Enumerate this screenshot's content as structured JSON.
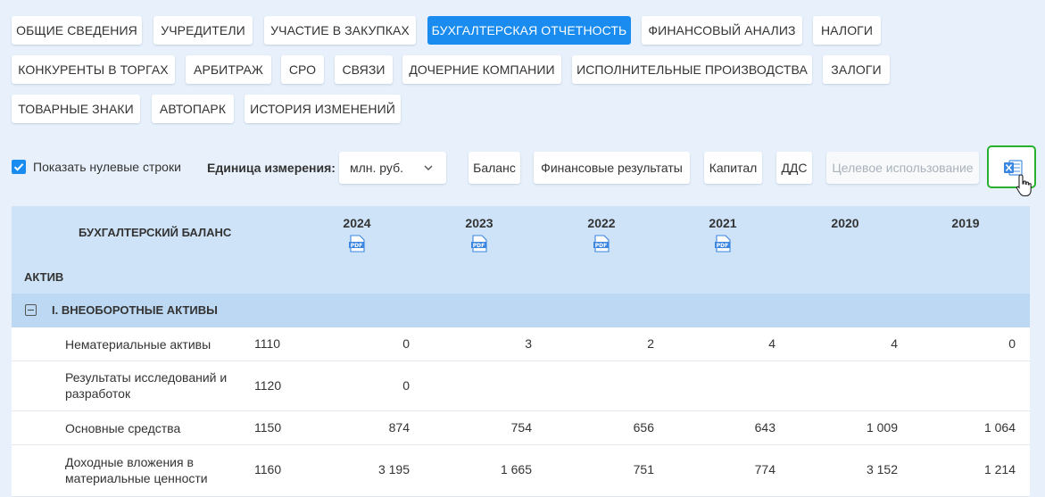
{
  "tabs_row1": [
    "ОБЩИЕ СВЕДЕНИЯ",
    "УЧРЕДИТЕЛИ",
    "УЧАСТИЕ В ЗАКУПКАХ",
    "БУХГАЛТЕРСКАЯ ОТЧЕТНОСТЬ",
    "ФИНАНСОВЫЙ АНАЛИЗ",
    "НАЛОГИ"
  ],
  "tabs_row2": [
    "КОНКУРЕНТЫ В ТОРГАХ",
    "АРБИТРАЖ",
    "СРО",
    "СВЯЗИ",
    "ДОЧЕРНИЕ КОМПАНИИ",
    "ИСПОЛНИТЕЛЬНЫЕ ПРОИЗВОДСТВА",
    "ЗАЛОГИ"
  ],
  "tabs_row3": [
    "ТОВАРНЫЕ ЗНАКИ",
    "АВТОПАРК",
    "ИСТОРИЯ ИЗМЕНЕНИЙ"
  ],
  "active_tab": "БУХГАЛТЕРСКАЯ ОТЧЕТНОСТЬ",
  "toolbar": {
    "show_zero_rows": "Показать нулевые строки",
    "show_zero_checked": true,
    "unit_label": "Единица измерения:",
    "unit_value": "млн. руб.",
    "buttons": [
      "Баланс",
      "Финансовые результаты",
      "Капитал",
      "ДДС",
      "Целевое использование"
    ],
    "disabled_button": "Целевое использование",
    "export_icon": "excel-icon"
  },
  "table": {
    "title": "БУХГАЛТЕРСКИЙ БАЛАНС",
    "years": [
      "2024",
      "2023",
      "2022",
      "2021",
      "2020",
      "2019"
    ],
    "pdf_years": [
      "2024",
      "2023",
      "2022",
      "2021"
    ],
    "group": "АКТИВ",
    "section": "I. ВНЕОБОРОТНЫЕ АКТИВЫ",
    "rows": [
      {
        "name": "Нематериальные активы",
        "code": "1110",
        "values": [
          "0",
          "3",
          "2",
          "4",
          "4",
          "0"
        ]
      },
      {
        "name": "Результаты исследований и разработок",
        "code": "1120",
        "values": [
          "0",
          "",
          "",
          "",
          "",
          ""
        ]
      },
      {
        "name": "Основные средства",
        "code": "1150",
        "values": [
          "874",
          "754",
          "656",
          "643",
          "1 009",
          "1 064"
        ]
      },
      {
        "name": "Доходные вложения в материальные ценности",
        "code": "1160",
        "values": [
          "3 195",
          "1 665",
          "751",
          "774",
          "3 152",
          "1 214"
        ]
      }
    ]
  },
  "colors": {
    "accent": "#1a8cf0",
    "excel_border": "#26b12f",
    "header_bg": "#cfe3f8"
  }
}
